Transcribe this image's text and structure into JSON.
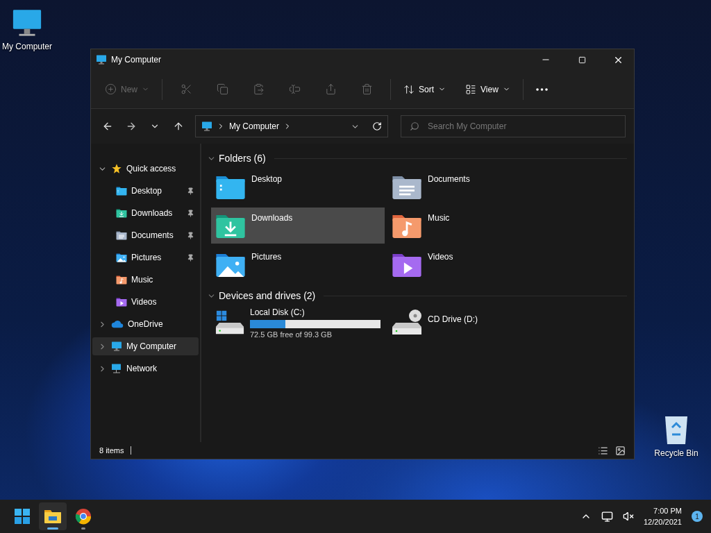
{
  "desktop_icons": [
    {
      "label": "My Computer",
      "kind": "computer"
    },
    {
      "label": "Recycle Bin",
      "kind": "recycle"
    }
  ],
  "window": {
    "title": "My Computer"
  },
  "toolbar": {
    "new": {
      "label": "New",
      "disabled": true
    },
    "actions": [
      {
        "kind": "cut",
        "disabled": true
      },
      {
        "kind": "copy",
        "disabled": true
      },
      {
        "kind": "paste",
        "disabled": true
      },
      {
        "kind": "rename",
        "disabled": true
      },
      {
        "kind": "share",
        "disabled": true
      },
      {
        "kind": "delete",
        "disabled": true
      }
    ],
    "sort": {
      "label": "Sort"
    },
    "view": {
      "label": "View"
    }
  },
  "address": {
    "path": "My Computer"
  },
  "search": {
    "placeholder": "Search My Computer"
  },
  "sidebar": {
    "items": [
      {
        "label": "Quick access",
        "kind": "star",
        "expanded": true,
        "selected": false,
        "children": [
          {
            "label": "Desktop",
            "kind": "desktop",
            "pinned": true,
            "selected": false
          },
          {
            "label": "Downloads",
            "kind": "downloads",
            "pinned": true,
            "selected": false
          },
          {
            "label": "Documents",
            "kind": "documents",
            "pinned": true,
            "selected": false
          },
          {
            "label": "Pictures",
            "kind": "pictures",
            "pinned": true,
            "selected": false
          },
          {
            "label": "Music",
            "kind": "music",
            "pinned": false,
            "selected": false
          },
          {
            "label": "Videos",
            "kind": "videos",
            "pinned": false,
            "selected": false
          }
        ]
      },
      {
        "label": "OneDrive",
        "kind": "cloud",
        "expanded": false,
        "selected": false
      },
      {
        "label": "My Computer",
        "kind": "computer",
        "expanded": false,
        "selected": true
      },
      {
        "label": "Network",
        "kind": "network",
        "expanded": false,
        "selected": false
      }
    ]
  },
  "folders": {
    "title": "Folders (6)",
    "expanded": true,
    "items": [
      {
        "label": "Desktop",
        "kind": "desktop",
        "selected": false
      },
      {
        "label": "Documents",
        "kind": "documents",
        "selected": false
      },
      {
        "label": "Downloads",
        "kind": "downloads",
        "selected": true
      },
      {
        "label": "Music",
        "kind": "music",
        "selected": false
      },
      {
        "label": "Pictures",
        "kind": "pictures",
        "selected": false
      },
      {
        "label": "Videos",
        "kind": "videos",
        "selected": false
      }
    ]
  },
  "drives": {
    "title": "Devices and drives (2)",
    "expanded": true,
    "items": [
      {
        "label": "Local Disk (C:)",
        "kind": "disk",
        "level": 0.27,
        "reading": "72.5 GB free of 99.3 GB"
      },
      {
        "label": "CD Drive (D:)",
        "kind": "cd"
      }
    ]
  },
  "status_bar": {
    "count": "8 items"
  },
  "taskbar": {
    "apps": [
      {
        "kind": "start",
        "active": false
      },
      {
        "kind": "explorer",
        "active": true,
        "open": true
      },
      {
        "kind": "chrome",
        "active": false,
        "open": true
      }
    ],
    "time": "7:00 PM",
    "date": "12/20/2021",
    "notifications": "1"
  }
}
